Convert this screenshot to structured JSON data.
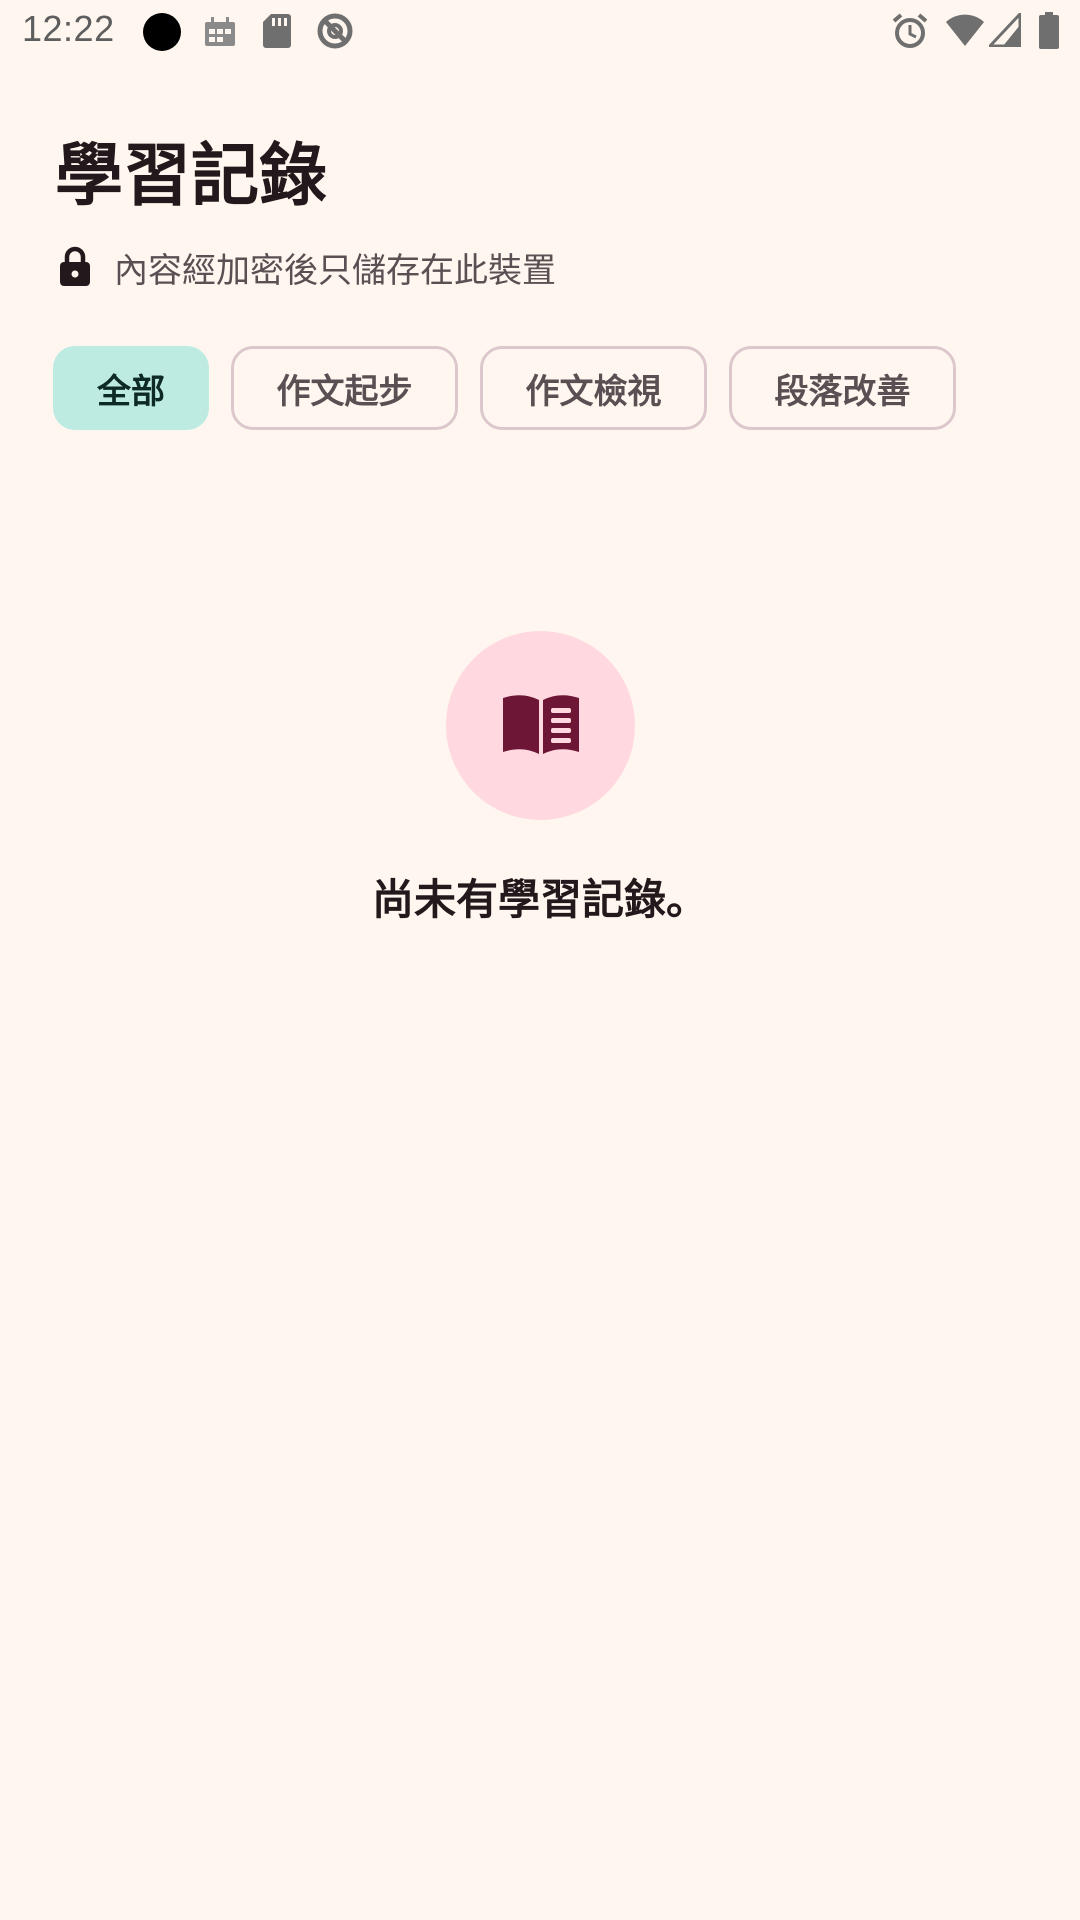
{
  "status_bar": {
    "time": "12:22",
    "left_icons": [
      "recording-dot-icon",
      "calendar-icon",
      "sd-card-icon",
      "sync-icon"
    ],
    "right_icons": [
      "alarm-icon",
      "wifi-icon",
      "cell-signal-icon",
      "battery-icon"
    ]
  },
  "header": {
    "title": "學習記錄",
    "privacy_note": "內容經加密後只儲存在此裝置"
  },
  "filters": {
    "chips": [
      {
        "label": "全部",
        "selected": true
      },
      {
        "label": "作文起步",
        "selected": false
      },
      {
        "label": "作文檢視",
        "selected": false
      },
      {
        "label": "段落改善",
        "selected": false
      }
    ]
  },
  "empty_state": {
    "icon": "open-book-icon",
    "message": "尚未有學習記錄。"
  },
  "colors": {
    "background": "#FFF7EF",
    "selected_chip": "#BDEBE2",
    "chip_border": "#DCC8CC",
    "empty_circle": "#FFD9DF",
    "book_icon": "#6E1636"
  }
}
